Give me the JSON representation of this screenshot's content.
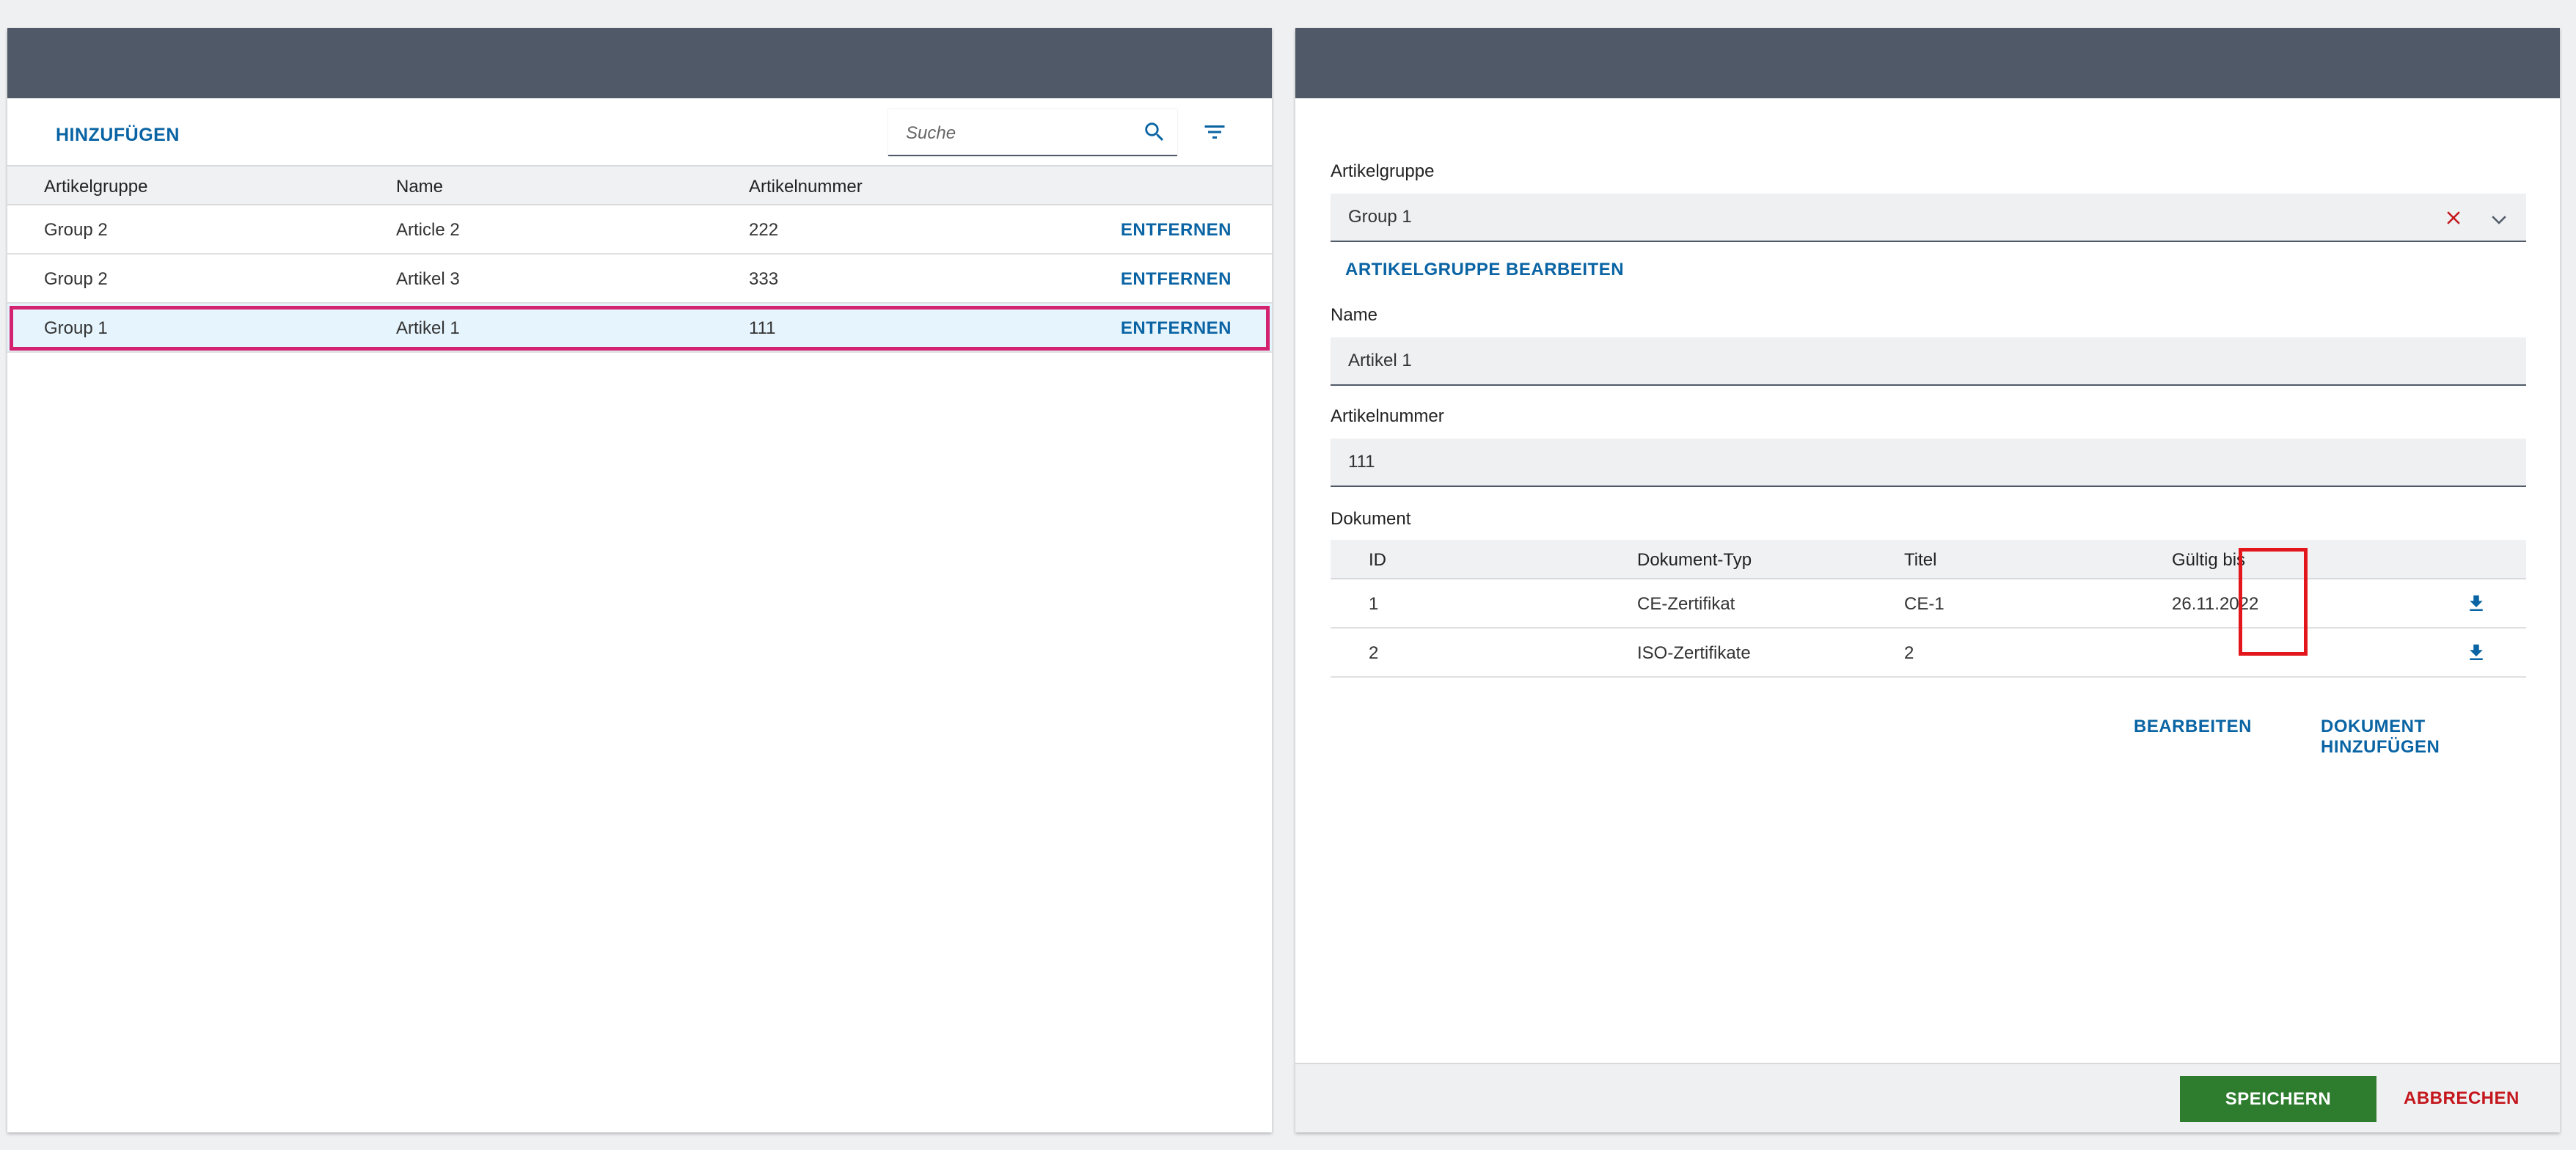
{
  "list_panel": {
    "add_label": "HINZUFÜGEN",
    "search_placeholder": "Suche",
    "columns": [
      "Artikelgruppe",
      "Name",
      "Artikelnummer"
    ],
    "rows": [
      {
        "group": "Group 2",
        "name": "Article 2",
        "number": "222",
        "action": "ENTFERNEN"
      },
      {
        "group": "Group 2",
        "name": "Artikel 3",
        "number": "333",
        "action": "ENTFERNEN"
      },
      {
        "group": "Group 1",
        "name": "Artikel 1",
        "number": "111",
        "action": "ENTFERNEN",
        "selected": true
      }
    ]
  },
  "detail_panel": {
    "group_label": "Artikelgruppe",
    "group_value": "Group 1",
    "edit_group_label": "ARTIKELGRUPPE BEARBEITEN",
    "name_label": "Name",
    "name_value": "Artikel 1",
    "number_label": "Artikelnummer",
    "number_value": "111",
    "documents_label": "Dokument",
    "doc_columns": [
      "ID",
      "Dokument-Typ",
      "Titel",
      "Gültig bis"
    ],
    "documents": [
      {
        "id": "1",
        "type": "CE-Zertifikat",
        "title": "CE-1",
        "valid_until": "26.11.2022"
      },
      {
        "id": "2",
        "type": "ISO-Zertifikate",
        "title": "2",
        "valid_until": ""
      }
    ],
    "edit_label": "BEARBEITEN",
    "add_document_label": "DOKUMENT HINZUFÜGEN",
    "save_label": "SPEICHERN",
    "cancel_label": "ABBRECHEN"
  },
  "colors": {
    "header": "#4f5967",
    "accent": "#0a64a4",
    "save": "#2e7d2e",
    "cancel": "#c4161c",
    "selection_outline": "#d3226f",
    "highlight_box": "#e3161b"
  }
}
